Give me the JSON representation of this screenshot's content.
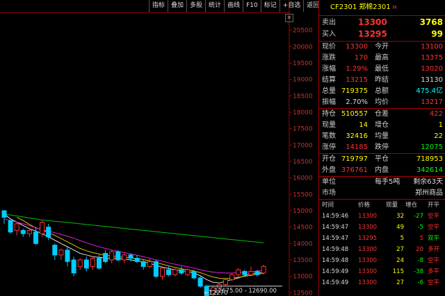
{
  "toolbar": {
    "buttons": [
      "指标",
      "叠加",
      "多股",
      "统计",
      "画线",
      "F10",
      "标记",
      "+自选",
      "返回"
    ]
  },
  "chart_data": {
    "type": "candlestick",
    "y_ticks": [
      "20500",
      "20000",
      "19500",
      "19000",
      "18500",
      "18000",
      "17500",
      "17000",
      "16500",
      "16000",
      "15500",
      "15000",
      "14500",
      "14000",
      "13500",
      "13000",
      "12500"
    ],
    "ylim": [
      12400,
      21000
    ],
    "high_annotation": "12675.00 - 12690.00",
    "low_annotation": "12270",
    "candles": [
      [
        15000,
        14800,
        14950,
        14600
      ],
      [
        14700,
        14350,
        14750,
        14300
      ],
      [
        14400,
        14600,
        14650,
        14250
      ],
      [
        14400,
        14300,
        14450,
        14200
      ],
      [
        14300,
        14400,
        14450,
        14200
      ],
      [
        14350,
        14000,
        14500,
        13950
      ],
      [
        14300,
        14650,
        14700,
        14200
      ],
      [
        14500,
        14200,
        14600,
        14100
      ],
      [
        13950,
        13650,
        14000,
        13500
      ],
      [
        13650,
        13800,
        13850,
        13500
      ],
      [
        13800,
        13450,
        13900,
        13300
      ],
      [
        13500,
        13100,
        13600,
        13000
      ],
      [
        13300,
        13500,
        13550,
        13200
      ],
      [
        13500,
        13250,
        13600,
        13150
      ],
      [
        13300,
        13550,
        13600,
        13200
      ],
      [
        13550,
        13250,
        13650,
        13200
      ],
      [
        13700,
        13450,
        13800,
        13400
      ],
      [
        13500,
        13750,
        13800,
        13400
      ],
      [
        13750,
        13500,
        13800,
        13450
      ],
      [
        13500,
        13650,
        13700,
        13400
      ],
      [
        13650,
        13550,
        13700,
        13450
      ],
      [
        13550,
        13450,
        13650,
        13400
      ],
      [
        13450,
        13300,
        13500,
        13200
      ],
      [
        13300,
        13450,
        13550,
        13250
      ],
      [
        13450,
        13000,
        13500,
        12950
      ],
      [
        13000,
        13250,
        13300,
        12900
      ],
      [
        13200,
        13050,
        13300,
        13000
      ],
      [
        13050,
        13200,
        13250,
        13000
      ],
      [
        13200,
        13100,
        13300,
        13050
      ],
      [
        13050,
        13200,
        13250,
        13000
      ],
      [
        13150,
        12950,
        13200,
        12900
      ],
      [
        12950,
        12700,
        13000,
        12650
      ],
      [
        12700,
        12400,
        12750,
        12270
      ],
      [
        12450,
        12650,
        12700,
        12400
      ],
      [
        12650,
        12750,
        12800,
        12550
      ],
      [
        12750,
        12900,
        12950,
        12700
      ],
      [
        12900,
        13050,
        13100,
        12850
      ],
      [
        13050,
        13200,
        13250,
        13000
      ],
      [
        13150,
        13050,
        13200,
        13000
      ],
      [
        13050,
        13150,
        13300,
        13000
      ],
      [
        13150,
        13050,
        13200,
        13000
      ],
      [
        13100,
        13300,
        13350,
        13050
      ]
    ],
    "ma_series": [
      {
        "color": "#e0e0e0",
        "values": [
          14900,
          14750,
          14650,
          14550,
          14450,
          14380,
          14300,
          14200,
          14100,
          14000,
          13900,
          13800,
          13700,
          13650,
          13600,
          13580,
          13560,
          13550,
          13540,
          13520,
          13500,
          13470,
          13440,
          13400,
          13330,
          13280,
          13240,
          13200,
          13170,
          13150,
          13100,
          13020,
          12900,
          12820,
          12800,
          12850,
          12900,
          12950,
          13020,
          13080,
          13100,
          13120
        ]
      },
      {
        "color": "#e0c000",
        "values": [
          null,
          null,
          14800,
          14700,
          14580,
          14480,
          14420,
          14330,
          14250,
          14150,
          14050,
          13950,
          13850,
          13780,
          13720,
          13680,
          13640,
          13620,
          13600,
          13580,
          13560,
          13540,
          13510,
          13470,
          13420,
          13370,
          13320,
          13270,
          13230,
          13200,
          13160,
          13110,
          13040,
          12980,
          12940,
          12930,
          12940,
          12970,
          13000,
          13030,
          13060,
          13090
        ]
      },
      {
        "color": "#e020e0",
        "values": [
          14750,
          14700,
          14650,
          14600,
          14550,
          14480,
          14420,
          14380,
          14330,
          14280,
          14220,
          14160,
          14090,
          14020,
          13960,
          13900,
          13850,
          13800,
          13760,
          13720,
          13680,
          13640,
          13600,
          13550,
          13500,
          13460,
          13410,
          13370,
          13330,
          13290,
          13250,
          13200,
          13160,
          13130,
          13110,
          13100,
          13100,
          13110,
          13120,
          13140,
          13160,
          13180
        ]
      },
      {
        "color": "#00c000",
        "values": [
          14900,
          14870,
          14840,
          14810,
          14780,
          14750,
          14720,
          14700,
          14680,
          14660,
          14640,
          14620,
          14600,
          14580,
          14560,
          14540,
          14520,
          14500,
          14480,
          14460,
          14440,
          14420,
          14400,
          14380,
          14360,
          14340,
          14320,
          14300,
          14280,
          14260,
          14240,
          14220,
          14200,
          14180,
          14160,
          14140,
          14120,
          14100,
          14080,
          14060,
          14040,
          14020
        ]
      }
    ]
  },
  "panel": {
    "title_code": "CF2301",
    "title_name": "郑棉2301",
    "title_mark": "M",
    "sell_label": "卖出",
    "sell_price": "13300",
    "sell_vol": "3768",
    "buy_label": "买入",
    "buy_price": "13295",
    "buy_vol": "99",
    "quote_rows": [
      [
        "现价",
        "13300",
        "今开",
        "13100"
      ],
      [
        "涨跌",
        "170",
        "最高",
        "13375"
      ],
      [
        "涨幅",
        "1.29%",
        "最低",
        "13020"
      ],
      [
        "结算",
        "13215",
        "昨结",
        "13130"
      ],
      [
        "总量",
        "719375",
        "总额",
        "475.4亿"
      ],
      [
        "振幅",
        "2.70%",
        "均价",
        "13217"
      ]
    ],
    "pos_rows": [
      [
        "持仓",
        "510557",
        "仓差",
        "422"
      ],
      [
        "现量",
        "14",
        "增仓",
        "1"
      ],
      [
        "笔数",
        "32416",
        "均量",
        "22"
      ],
      [
        "涨停",
        "14185",
        "跌停",
        "12075"
      ]
    ],
    "open_rows": [
      [
        "开仓",
        "719797",
        "平仓",
        "718953"
      ],
      [
        "外盘",
        "376761",
        "内盘",
        "342614"
      ]
    ],
    "unit_label": "单位",
    "unit_value": "每手5吨",
    "remain_label": "剩余63天",
    "market_label": "市场",
    "market_value": "郑州商品",
    "tick_header": [
      "时间",
      "价格",
      "现量",
      "增仓",
      "开平"
    ],
    "ticks": [
      [
        "14:59:46",
        "13300",
        "32",
        "-27",
        "空平"
      ],
      [
        "14:59:47",
        "13300",
        "49",
        "-5",
        "空平"
      ],
      [
        "14:59:47",
        "13295",
        "5",
        "5",
        "双平"
      ],
      [
        "14:59:48",
        "13300",
        "27",
        "20",
        "多开"
      ],
      [
        "14:59:48",
        "13300",
        "24",
        "-8",
        "空平"
      ],
      [
        "14:59:49",
        "13300",
        "115",
        "-38",
        "多平"
      ],
      [
        "14:59:49",
        "13300",
        "27",
        "-6",
        "空平"
      ]
    ]
  }
}
